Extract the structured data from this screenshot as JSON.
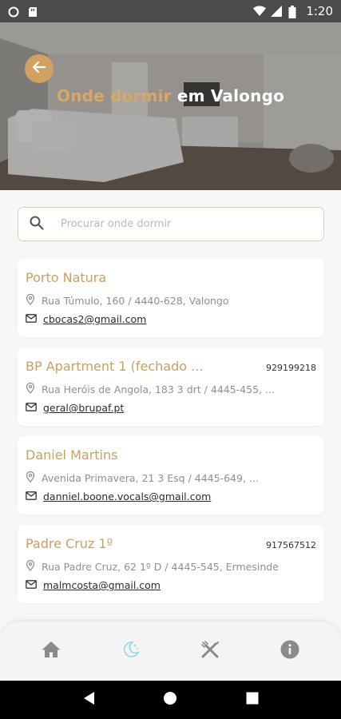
{
  "status_bar": {
    "time": "1:20"
  },
  "header": {
    "title_accent": "Onde dormir",
    "title_rest": " em Valongo"
  },
  "search": {
    "placeholder": "Procurar onde dormir",
    "value": ""
  },
  "listings": [
    {
      "name": "Porto Natura",
      "phone": "",
      "address": "Rua Túmulo, 160 / 4440-628, Valongo",
      "email": "cbocas2@gmail.com"
    },
    {
      "name": "BP Apartment 1 (fechado ...",
      "phone": "929199218",
      "address": "Rua Heróis de Angola, 183 3 drt / 4445-455, ...",
      "email": "geral@brupaf.pt"
    },
    {
      "name": "Daniel Martins",
      "phone": "",
      "address": "Avenida Primavera, 21 3 Esq / 4445-649, ...",
      "email": "danniel.boone.vocals@gmail.com"
    },
    {
      "name": "Padre Cruz 1º",
      "phone": "917567512",
      "address": "Rua Padre Cruz, 62 1º D / 4445-545, Ermesinde",
      "email": "malmcosta@gmail.com"
    }
  ],
  "bottom_nav": {
    "items": [
      {
        "icon": "home-icon",
        "active": false
      },
      {
        "icon": "moon-icon",
        "active": true
      },
      {
        "icon": "restaurant-icon",
        "active": false
      },
      {
        "icon": "info-icon",
        "active": false
      }
    ]
  },
  "colors": {
    "accent": "#d1a162",
    "title_accent": "#d9a866",
    "nav_active": "#7fd6e8",
    "nav_inactive": "#8a8a8a"
  }
}
